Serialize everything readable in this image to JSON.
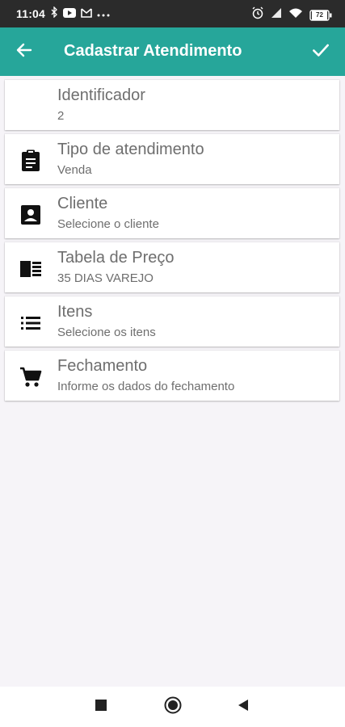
{
  "status_bar": {
    "time": "11:04",
    "left_icons": [
      "bluetooth-icon",
      "youtube-icon",
      "mail-icon",
      "more-icon"
    ],
    "right_icons": [
      "alarm-icon",
      "signal-icon",
      "wifi-icon",
      "battery-icon"
    ],
    "battery_level": "72"
  },
  "app_bar": {
    "title": "Cadastrar Atendimento",
    "back_icon": "arrow-back-icon",
    "confirm_icon": "check-icon",
    "color": "#26a69a"
  },
  "items": [
    {
      "title": "Identificador",
      "subtitle": "2",
      "icon": ""
    },
    {
      "title": "Tipo de atendimento",
      "subtitle": "Venda",
      "icon": "clipboard-icon"
    },
    {
      "title": "Cliente",
      "subtitle": "Selecione o cliente",
      "icon": "contact-icon"
    },
    {
      "title": "Tabela de Preço",
      "subtitle": "35 DIAS VAREJO",
      "icon": "price-table-icon"
    },
    {
      "title": "Itens",
      "subtitle": "Selecione os itens",
      "icon": "list-icon"
    },
    {
      "title": "Fechamento",
      "subtitle": "Informe os dados do fechamento",
      "icon": "cart-icon"
    }
  ],
  "nav_bar": {
    "buttons": [
      "recents-button",
      "home-button",
      "back-button"
    ]
  }
}
